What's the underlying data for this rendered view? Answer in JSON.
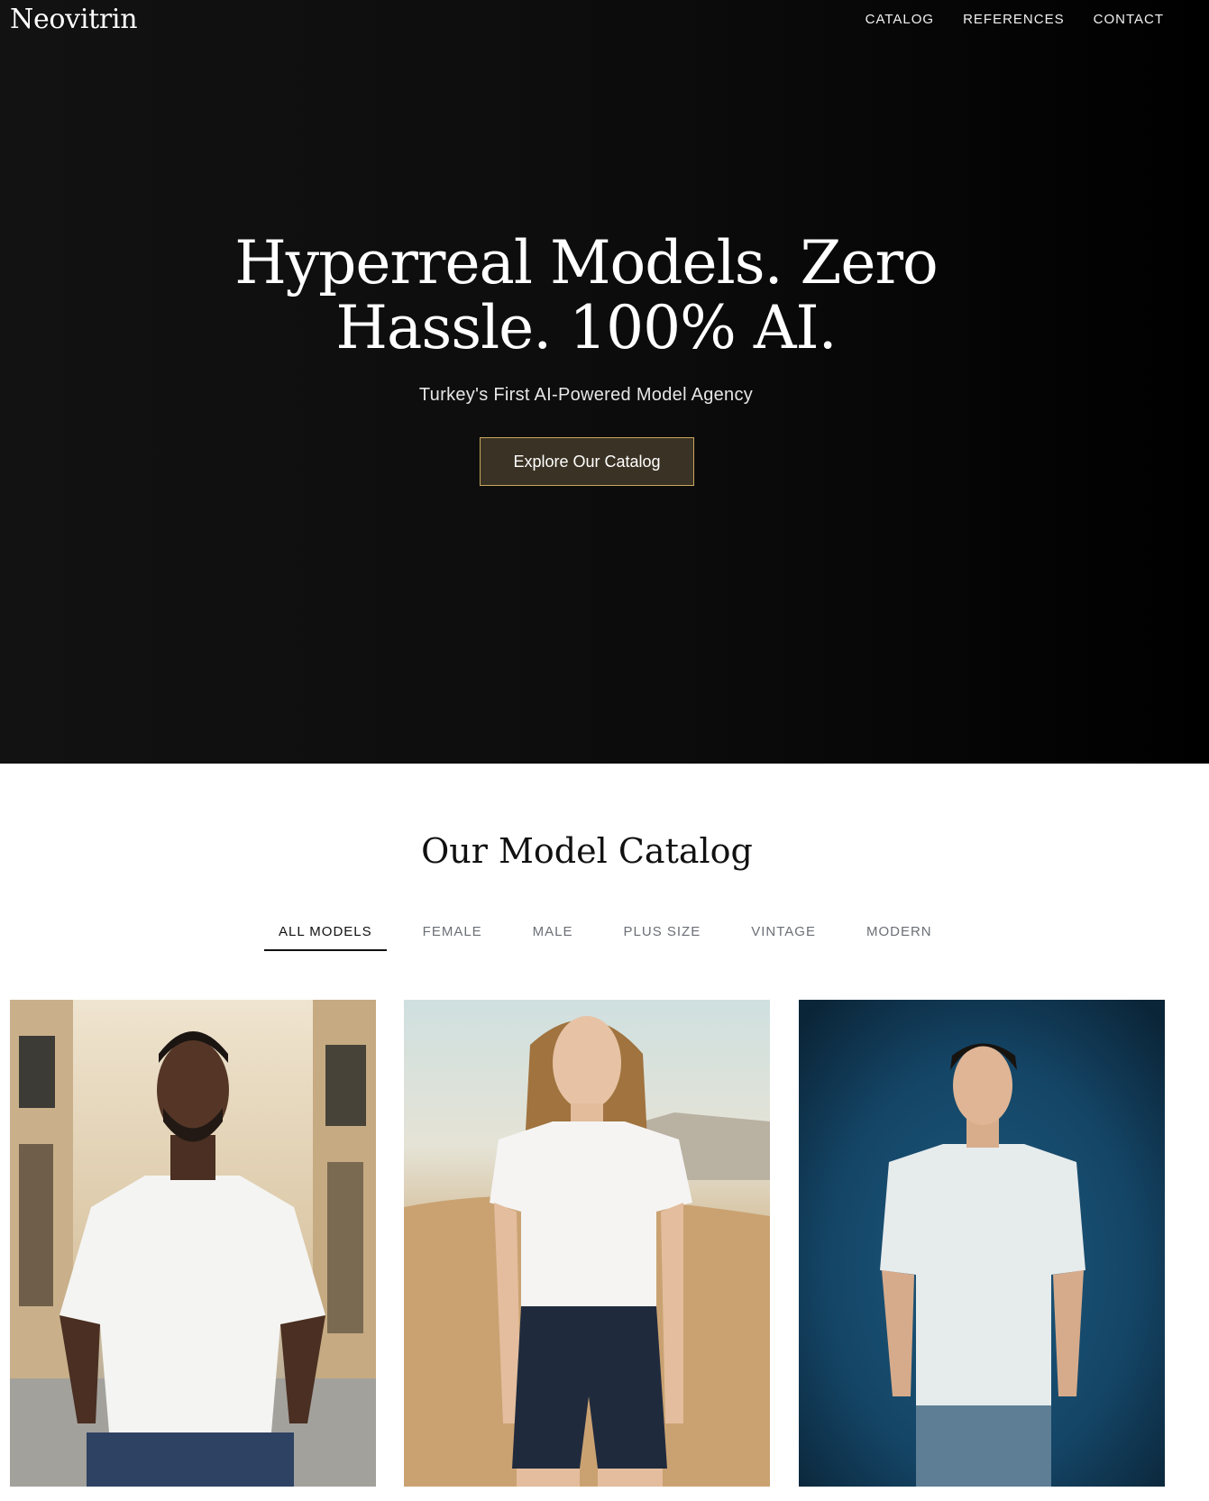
{
  "header": {
    "logo": "Neovitrin",
    "nav": [
      "CATALOG",
      "REFERENCES",
      "CONTACT"
    ]
  },
  "hero": {
    "title_line1": "Hyperreal Models. Zero",
    "title_line2": "Hassle. 100% AI.",
    "subtitle": "Turkey's First AI-Powered Model Agency",
    "cta_label": "Explore Our Catalog"
  },
  "catalog": {
    "title": "Our Model Catalog",
    "filters": [
      "ALL MODELS",
      "FEMALE",
      "MALE",
      "PLUS SIZE",
      "VINTAGE",
      "MODERN"
    ],
    "active_filter": "ALL MODELS"
  },
  "colors": {
    "cta_border": "#c8a85c",
    "cta_background": "#3a3224",
    "hero_background": "#0c0c0c"
  }
}
